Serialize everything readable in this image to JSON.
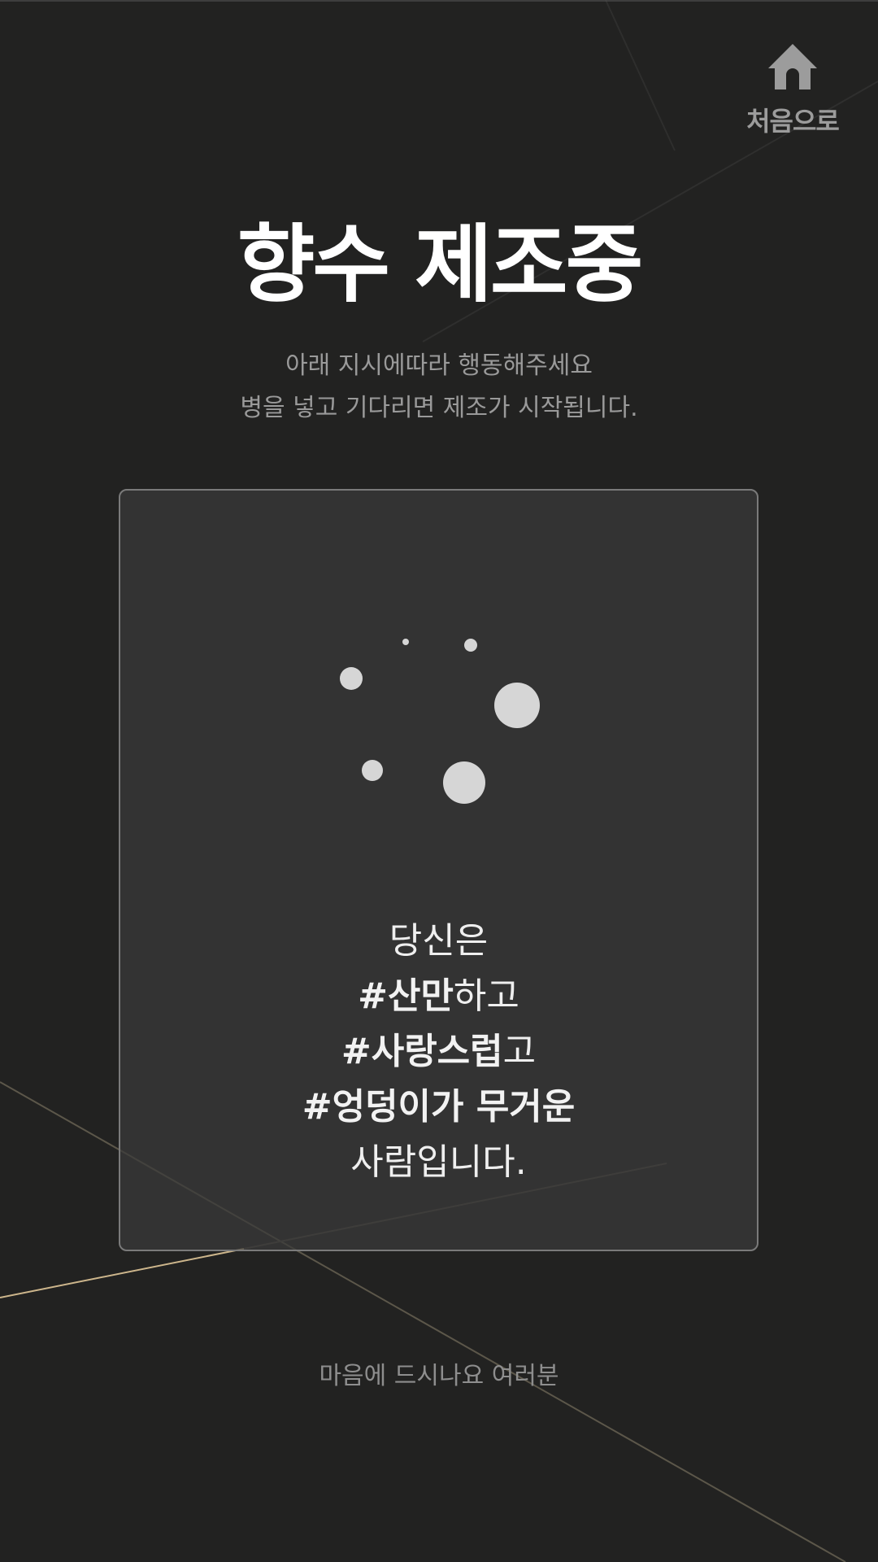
{
  "nav": {
    "home_icon": "home-icon",
    "home_label": "처음으로"
  },
  "header": {
    "title": "향수 제조중"
  },
  "instructions": [
    "아래 지시에따라 행동해주세요",
    "병을 넣고 기다리면 제조가 시작됩니다."
  ],
  "card": {
    "loader_icon": "loading-dots-icon",
    "result": {
      "intro": "당신은",
      "traits": [
        {
          "tag": "#산만",
          "suffix": "하고"
        },
        {
          "tag": "#사랑스럽",
          "suffix": "고"
        },
        {
          "tag": "#엉덩이가 무거운",
          "suffix": ""
        }
      ],
      "outro": "사람입니다."
    }
  },
  "footer": {
    "text": "마음에 드시나요 여러분"
  },
  "colors": {
    "background": "#222221",
    "card_background": "#333333",
    "card_border": "#7a7a7a",
    "accent_line": "#c8b48c",
    "text_primary": "#ffffff",
    "text_muted": "#9a9a9a"
  }
}
